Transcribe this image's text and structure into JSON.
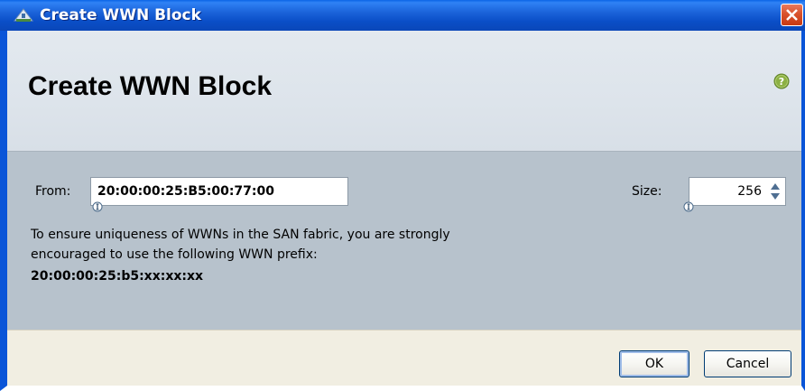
{
  "window": {
    "title": "Create WWN Block",
    "title_icon": "san-pool-icon",
    "close_icon": "close-icon"
  },
  "header": {
    "heading": "Create WWN Block",
    "help_icon": "help-icon"
  },
  "form": {
    "from_label": "From:",
    "from_value": "20:00:00:25:B5:00:77:00",
    "size_label": "Size:",
    "size_value": "256",
    "info_line_1": "To ensure uniqueness of WWNs in the SAN fabric, you are strongly",
    "info_line_2": "encouraged to use the following WWN prefix:",
    "wwn_prefix": "20:00:00:25:b5:xx:xx:xx"
  },
  "footer": {
    "ok_label": "OK",
    "cancel_label": "Cancel"
  },
  "colors": {
    "titlebar": "#0a55d8",
    "header_bg": "#e0e6ec",
    "content_bg": "#b7c2cc",
    "footer_bg": "#f1eee2",
    "close_button": "#d9512b",
    "help_icon": "#7fa33a"
  }
}
